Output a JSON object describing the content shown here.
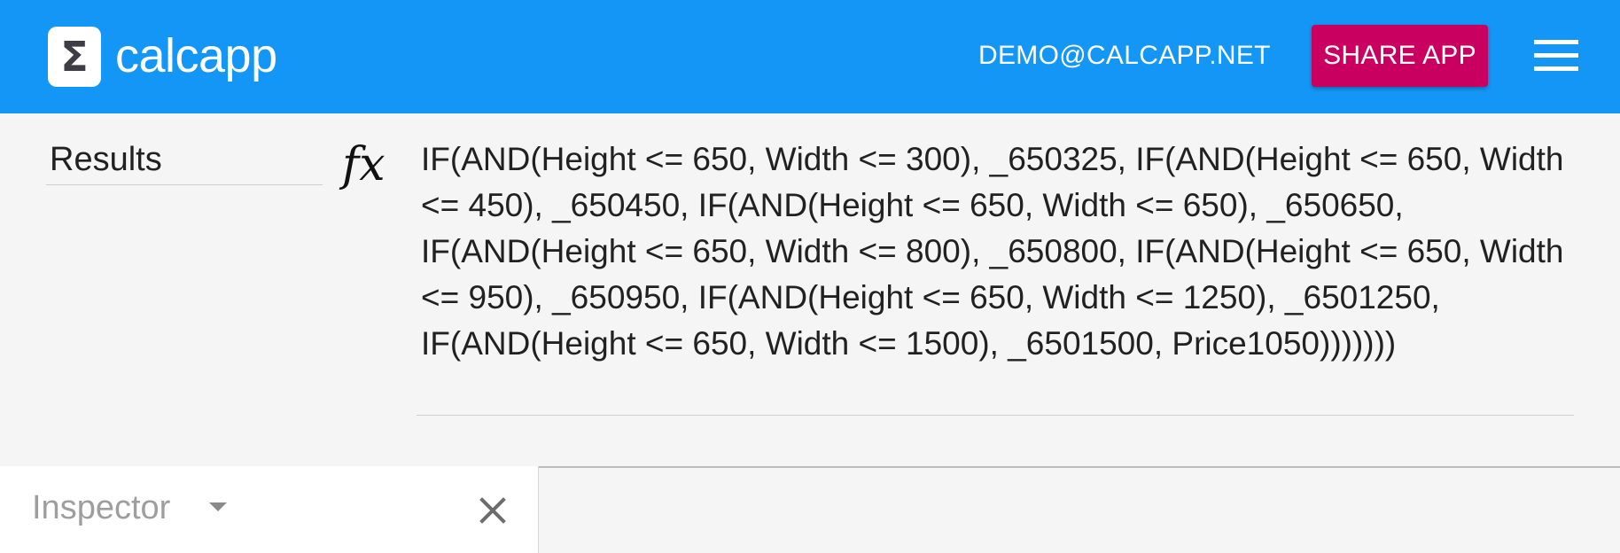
{
  "appbar": {
    "logo_glyph": "Σ",
    "app_name": "calcapp",
    "account": "DEMO@CALCAPP.NET",
    "share_label": "SHARE APP",
    "menu_icon": "hamburger-menu-icon",
    "background_color": "#1496f6",
    "share_color": "#c9005f"
  },
  "formula_bar": {
    "field_name": "Results",
    "fx_glyph": "fx",
    "formula": "IF(AND(Height <= 650, Width <= 300), _650325, IF(AND(Height <= 650, Width <= 450), _650450, IF(AND(Height <= 650, Width <= 650), _650650, IF(AND(Height <= 650, Width <= 800), _650800, IF(AND(Height <= 650, Width <= 950), _650950, IF(AND(Height <= 650, Width <= 1250), _6501250, IF(AND(Height <= 650, Width <= 1500), _6501500, Price1050)))))))"
  },
  "inspector": {
    "title": "Inspector",
    "dropdown_icon": "dropdown-arrow-icon",
    "close_icon": "close-icon"
  }
}
